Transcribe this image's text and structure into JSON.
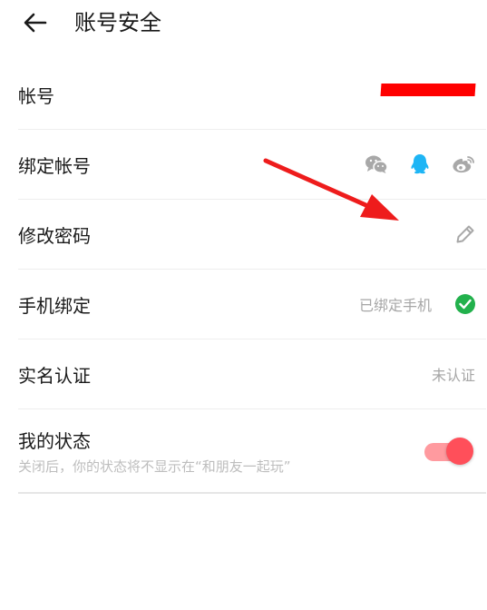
{
  "header": {
    "title": "账号安全"
  },
  "rows": {
    "account": {
      "label": "帐号"
    },
    "bind": {
      "label": "绑定帐号"
    },
    "password": {
      "label": "修改密码"
    },
    "phone": {
      "label": "手机绑定",
      "status": "已绑定手机"
    },
    "realname": {
      "label": "实名认证",
      "status": "未认证"
    },
    "mystatus": {
      "label": "我的状态",
      "description": "关闭后，你的状态将不显示在“和朋友一起玩”",
      "toggle_on": true
    }
  },
  "icons": {
    "back": "back-arrow-icon",
    "wechat": "wechat-icon",
    "qq": "qq-icon",
    "weibo": "weibo-icon",
    "edit": "pencil-icon",
    "verified": "check-circle-icon"
  },
  "colors": {
    "qq": "#1eb5f5",
    "verified": "#22b14c",
    "toggle_track": "#ff9a9f",
    "toggle_knob": "#ff4f5a",
    "redaction": "#ff0000",
    "annotation_arrow": "#ee1c1c",
    "icon_gray": "#a8a8a8"
  }
}
